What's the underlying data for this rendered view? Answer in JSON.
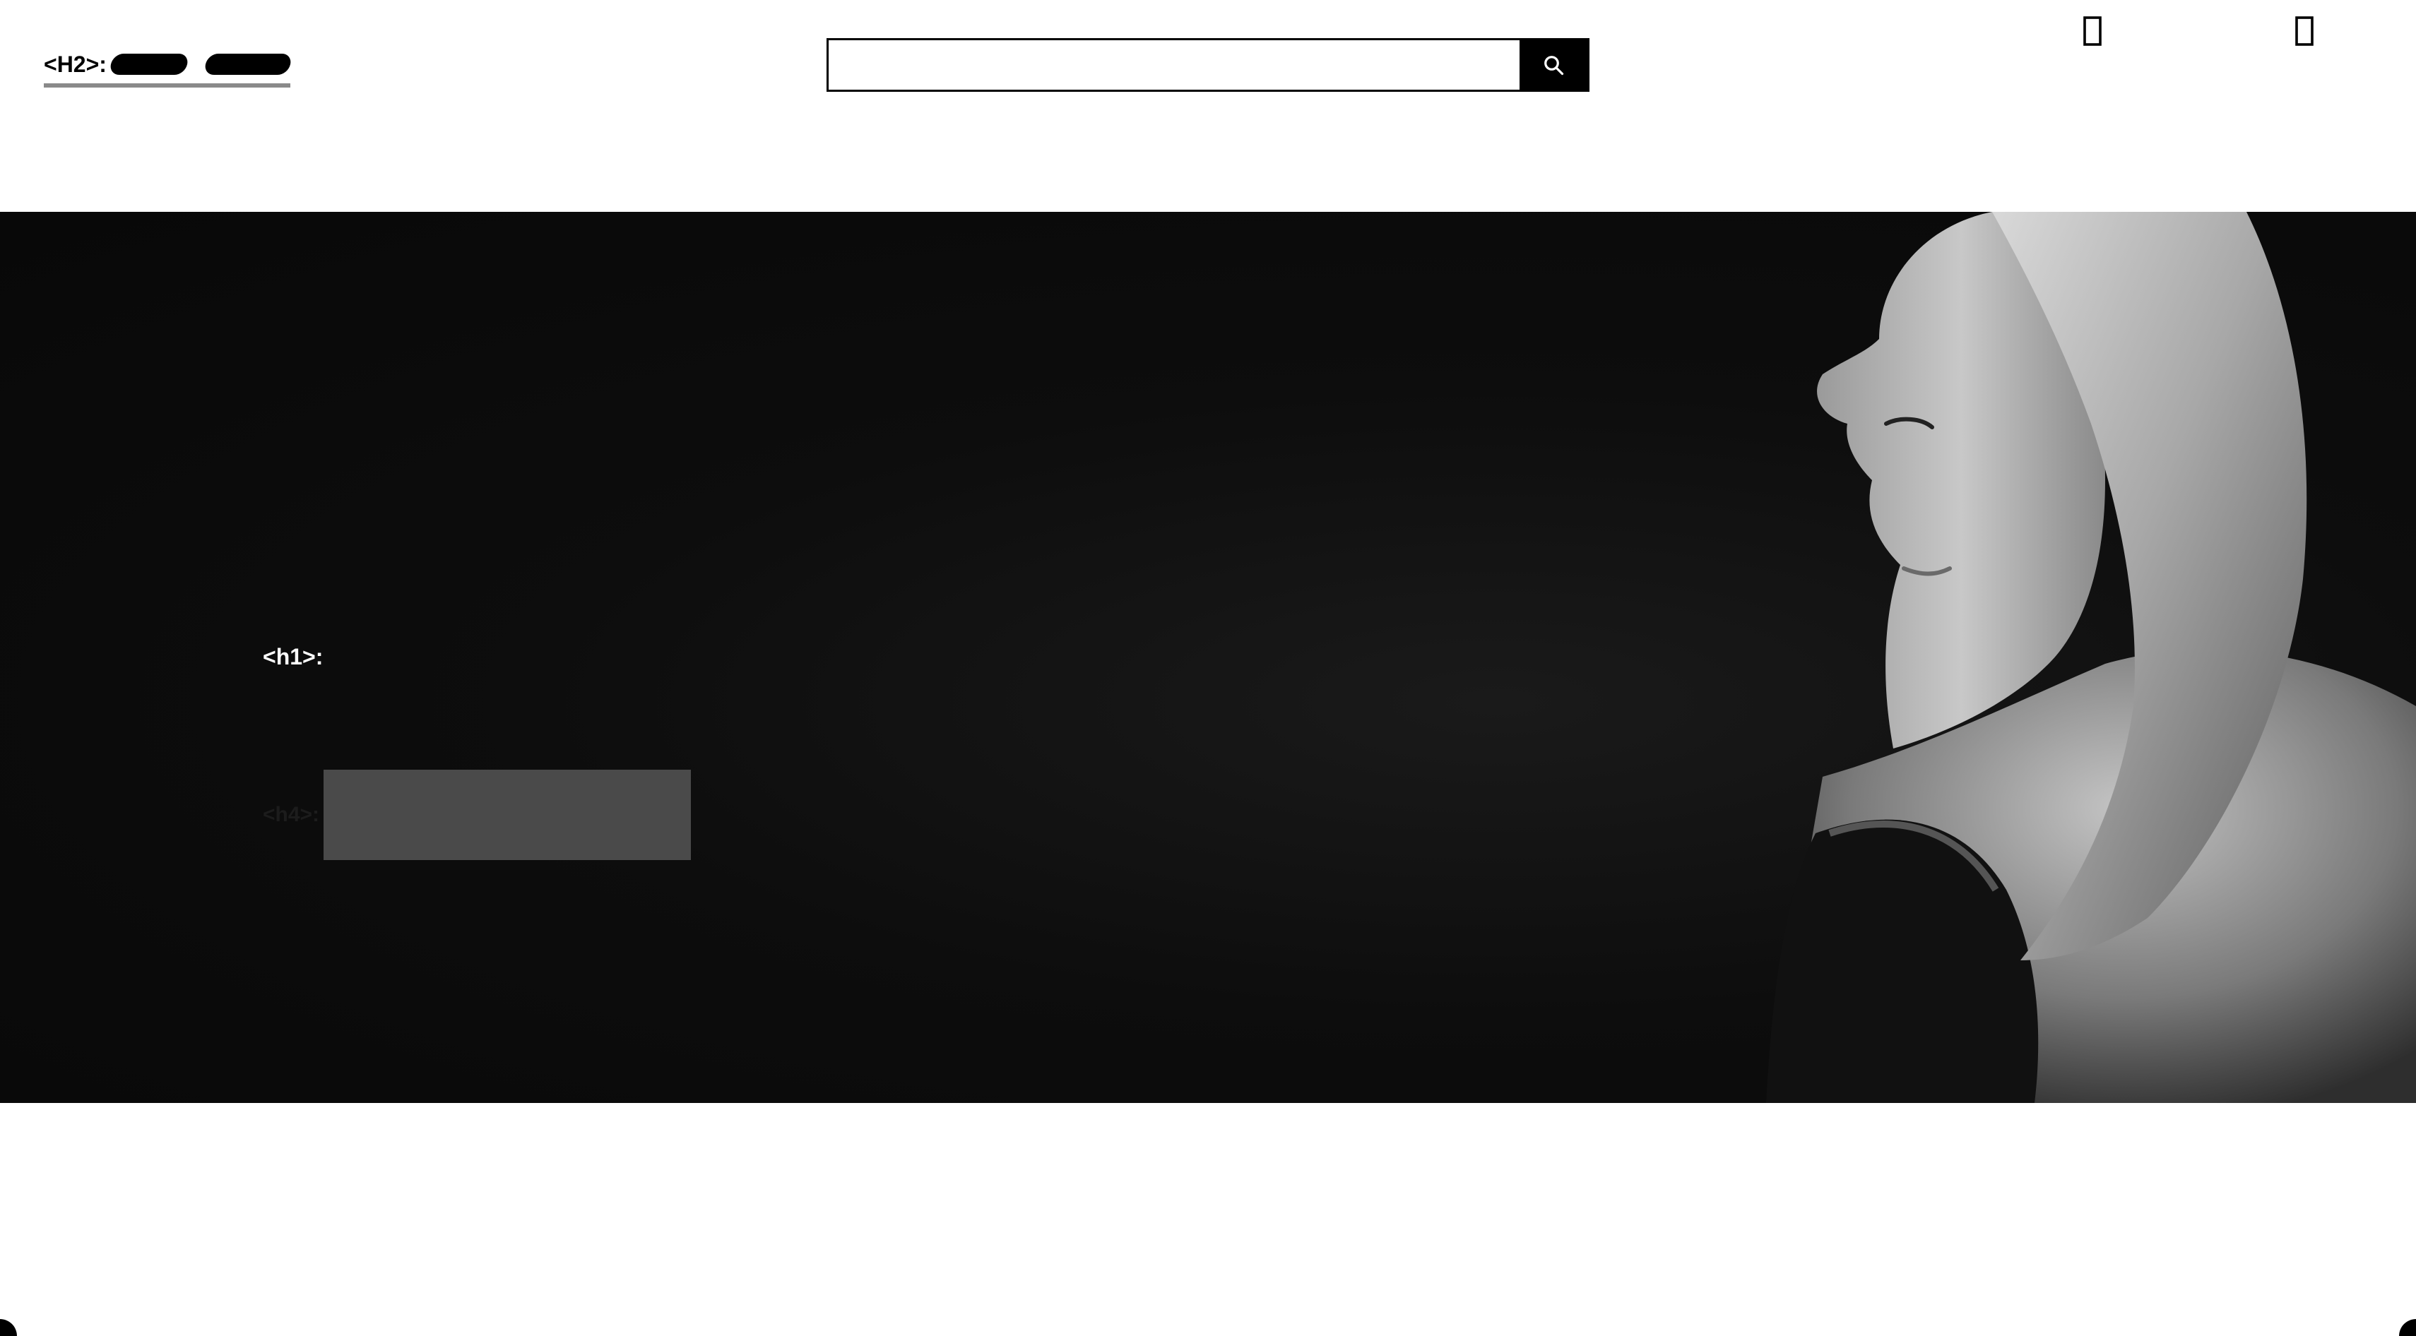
{
  "header": {
    "logo": {
      "tag": "<H2>:",
      "text": ""
    },
    "search": {
      "placeholder": "",
      "button_icon": "search-icon"
    },
    "actions": [
      {
        "icon": "user-icon",
        "label": ""
      },
      {
        "icon": "cart-icon",
        "label": ""
      }
    ]
  },
  "nav": {
    "items": [
      {
        "label": ""
      },
      {
        "label": ""
      },
      {
        "label": ""
      }
    ]
  },
  "hero": {
    "heading_tag": "<h1>:",
    "heading": "",
    "cta_tag": "<h4>:",
    "cta_label": "",
    "image": "woman-profile-photo"
  },
  "colors": {
    "hero_background": "#0a0a0a",
    "cta_background": "#4a4a4a",
    "search_button": "#000000",
    "logo_underline": "#8a8a8a"
  }
}
